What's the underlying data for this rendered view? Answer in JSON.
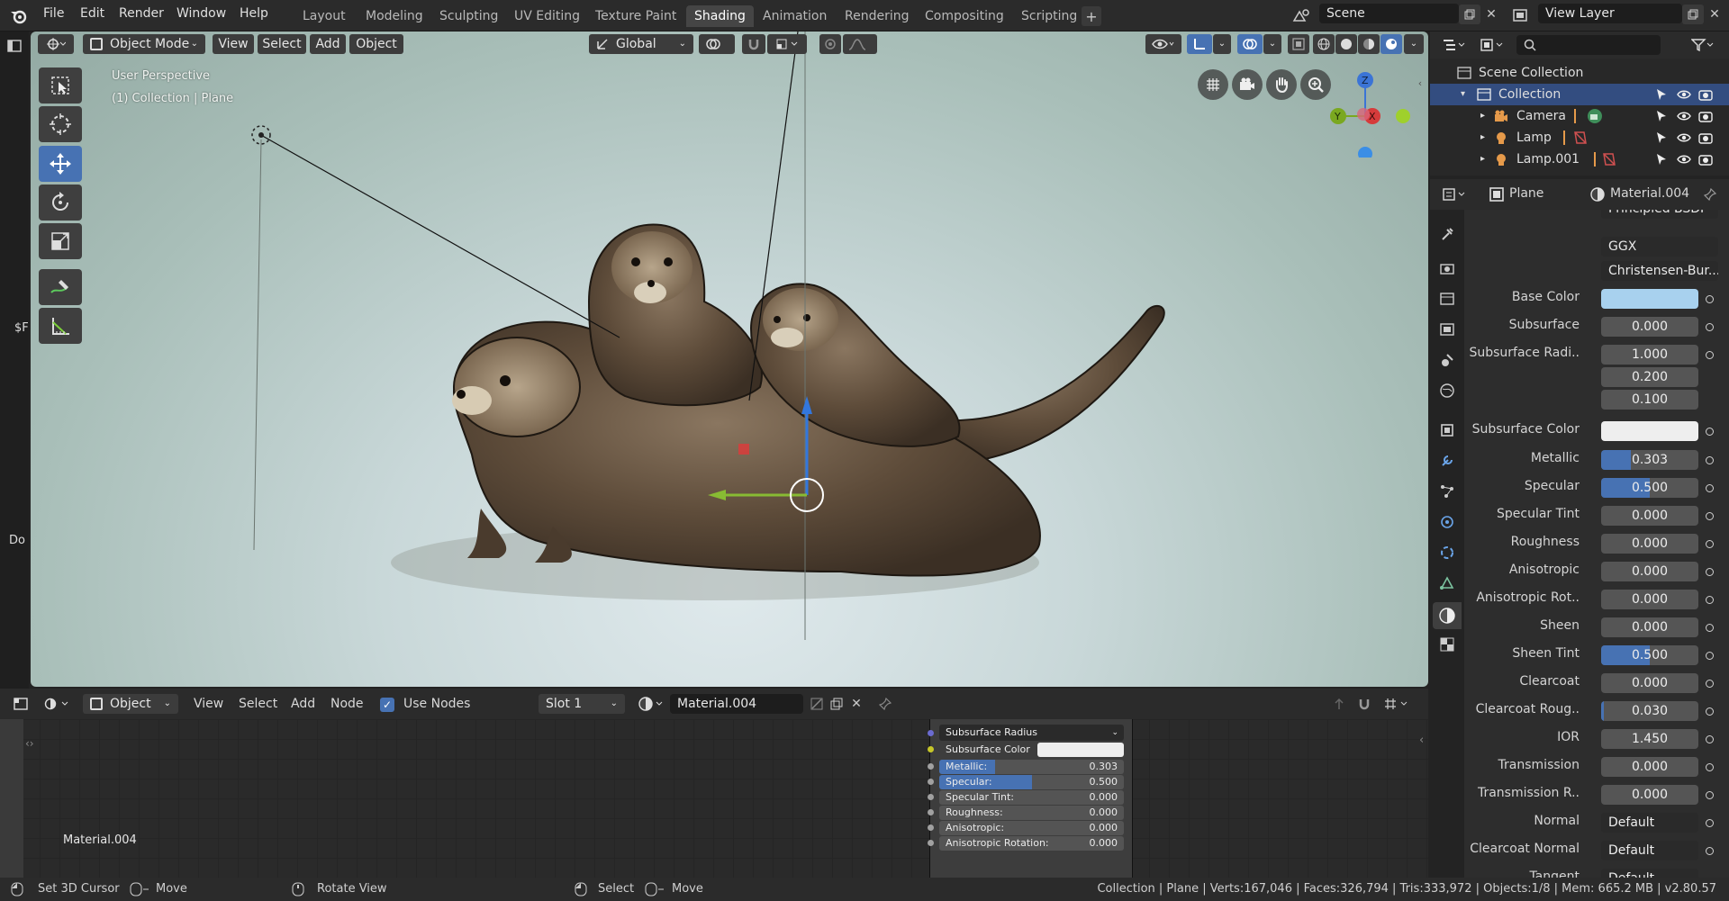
{
  "menu": [
    "File",
    "Edit",
    "Render",
    "Window",
    "Help"
  ],
  "workspaces": [
    "Layout",
    "Modeling",
    "Sculpting",
    "UV Editing",
    "Texture Paint",
    "Shading",
    "Animation",
    "Rendering",
    "Compositing",
    "Scripting"
  ],
  "active_workspace": "Shading",
  "scene": "Scene",
  "view_layer": "View Layer",
  "left_strip_text": [
    "$F",
    "Do"
  ],
  "viewport": {
    "mode": "Object Mode",
    "menus": [
      "View",
      "Select",
      "Add",
      "Object"
    ],
    "orientation": "Global",
    "perspective": "User Perspective",
    "context": "(1) Collection | Plane",
    "gizmo_axes": {
      "x": "X",
      "y": "Y",
      "z": "Z"
    }
  },
  "tools": [
    "select-box-icon",
    "cursor-icon",
    "move-icon",
    "rotate-icon",
    "scale-icon",
    "annotate-icon",
    "measure-icon"
  ],
  "outliner": {
    "root": "Scene Collection",
    "collection": "Collection",
    "items": [
      "Camera",
      "Lamp",
      "Lamp.001"
    ]
  },
  "properties": {
    "object": "Plane",
    "material": "Material.004",
    "distribution": "GGX",
    "subsurface_method": "Christensen-Bur...",
    "base_color": "#a8d1ee",
    "subsurface_color": "#eeeeee",
    "rows": [
      {
        "label": "Subsurface",
        "value": "0.000",
        "fill": 0
      },
      {
        "label": "Metallic",
        "value": "0.303",
        "fill": 0.303
      },
      {
        "label": "Specular",
        "value": "0.500",
        "fill": 0.5
      },
      {
        "label": "Specular Tint",
        "value": "0.000",
        "fill": 0
      },
      {
        "label": "Roughness",
        "value": "0.000",
        "fill": 0
      },
      {
        "label": "Anisotropic",
        "value": "0.000",
        "fill": 0
      },
      {
        "label": "Anisotropic Rot..",
        "value": "0.000",
        "fill": 0
      },
      {
        "label": "Sheen",
        "value": "0.000",
        "fill": 0
      },
      {
        "label": "Sheen Tint",
        "value": "0.500",
        "fill": 0.5
      },
      {
        "label": "Clearcoat",
        "value": "0.000",
        "fill": 0
      },
      {
        "label": "Clearcoat Roug..",
        "value": "0.030",
        "fill": 0.03
      },
      {
        "label": "IOR",
        "value": "1.450",
        "fill": 0
      },
      {
        "label": "Transmission",
        "value": "0.000",
        "fill": 0
      },
      {
        "label": "Transmission R..",
        "value": "0.000",
        "fill": 0
      }
    ],
    "subsurface_radius_label": "Subsurface Radi..",
    "subsurface_radius": [
      "1.000",
      "0.200",
      "0.100"
    ],
    "base_color_label": "Base Color",
    "subsurface_color_label": "Subsurface Color",
    "normal_label": "Normal",
    "normal_value": "Default",
    "clearcoat_normal_label": "Clearcoat Normal",
    "clearcoat_normal_value": "Default",
    "tangent_label": "Tangent",
    "tangent_value": "Default"
  },
  "node_editor": {
    "type": "Object",
    "menus": [
      "View",
      "Select",
      "Add",
      "Node"
    ],
    "use_nodes": "Use Nodes",
    "slot": "Slot 1",
    "material": "Material.004",
    "label": "Material.004",
    "subsurface_radius": "Subsurface Radius",
    "subsurface_color": "Subsurface Color",
    "rows": [
      {
        "label": "Metallic:",
        "value": "0.303",
        "fill": 0.303
      },
      {
        "label": "Specular:",
        "value": "0.500",
        "fill": 0.5
      },
      {
        "label": "Specular Tint:",
        "value": "0.000",
        "fill": 0
      },
      {
        "label": "Roughness:",
        "value": "0.000",
        "fill": 0
      },
      {
        "label": "Anisotropic:",
        "value": "0.000",
        "fill": 0
      },
      {
        "label": "Anisotropic Rotation:",
        "value": "0.000",
        "fill": 0
      }
    ]
  },
  "status": {
    "hints": [
      "Set 3D Cursor",
      "Move",
      "Rotate View",
      "Select",
      "Move"
    ],
    "stats": "Collection | Plane | Verts:167,046 | Faces:326,794 | Tris:333,972 | Objects:1/8 | Mem: 665.2 MB | v2.80.57"
  }
}
